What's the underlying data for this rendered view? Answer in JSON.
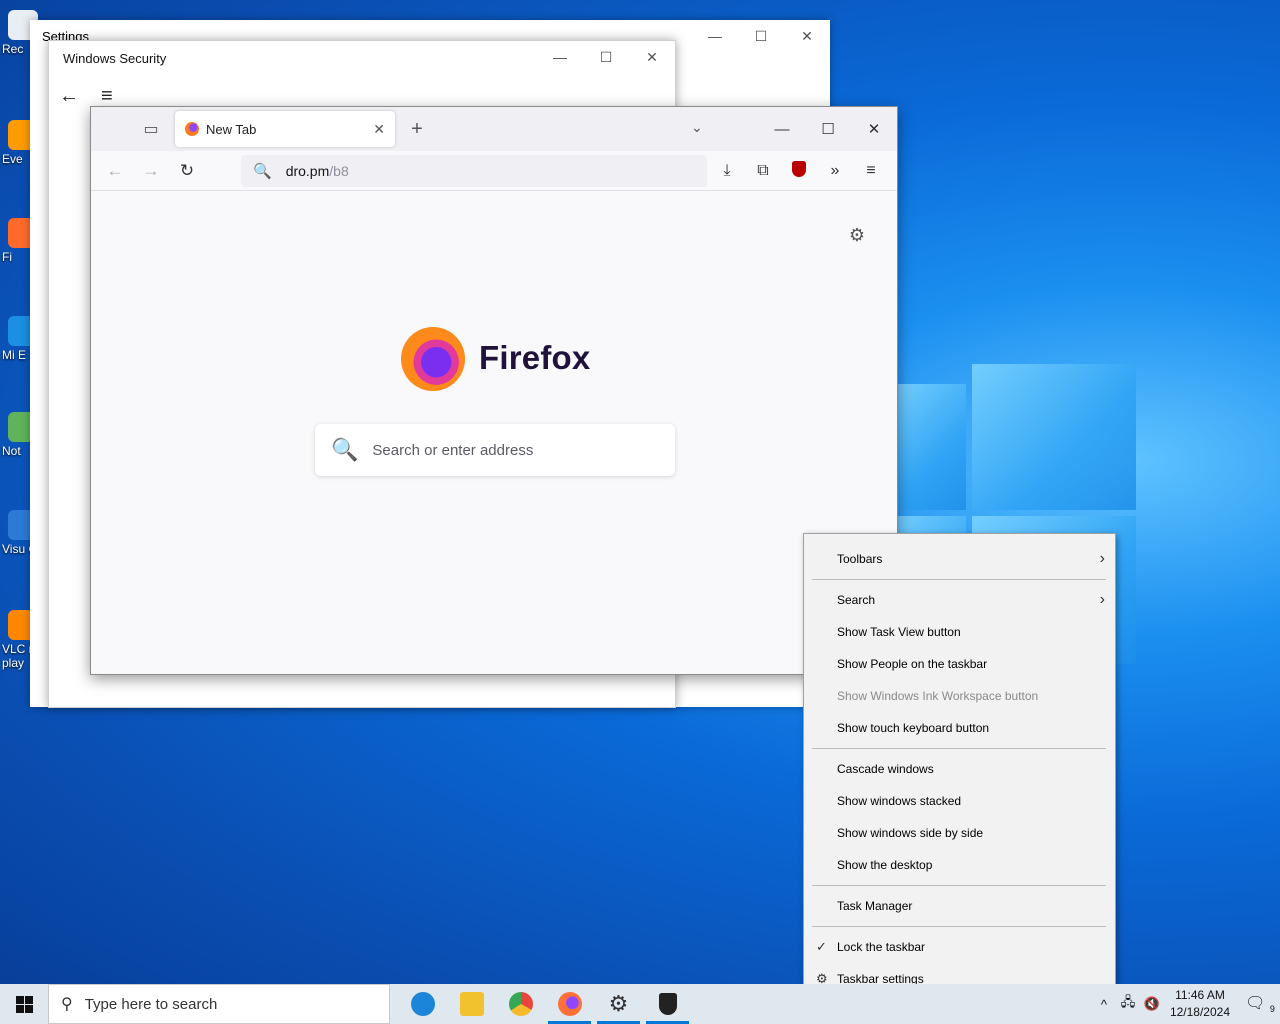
{
  "desktop": {
    "icons": [
      {
        "label": "Rec",
        "color": "#e9eef5"
      },
      {
        "label": "Eve",
        "color": "#ff9a00"
      },
      {
        "label": "Fi",
        "color": "#ff6a2b"
      },
      {
        "label": "Mi E",
        "color": "#1a8fe3"
      },
      {
        "label": "Not",
        "color": "#5fb35a"
      },
      {
        "label": "Visu C",
        "color": "#2c7ad6"
      },
      {
        "label": "VLC me play",
        "color": "#ff8800"
      }
    ]
  },
  "settings_window": {
    "title": "Settings",
    "controls": {
      "minimize": "—",
      "maximize": "☐",
      "close": "✕"
    }
  },
  "security_window": {
    "title": "Windows Security",
    "back_icon": "←",
    "menu_icon": "≡",
    "controls": {
      "minimize": "—",
      "maximize": "☐",
      "close": "✕"
    }
  },
  "firefox": {
    "tab": {
      "label": "New Tab",
      "close": "✕"
    },
    "new_tab": "+",
    "list_tabs": "⌄",
    "controls": {
      "minimize": "—",
      "maximize": "☐",
      "close": "✕"
    },
    "nav": {
      "back": "←",
      "forward": "→",
      "reload": "↻"
    },
    "url": {
      "host": "dro.pm",
      "path": "/b8",
      "icon": "🔍"
    },
    "tools": {
      "download": "⤓",
      "extensions": "⧉",
      "overflow": "»",
      "menu": "≡"
    },
    "content": {
      "settings_icon": "⚙",
      "wordmark": "Firefox",
      "search_placeholder": "Search or enter address",
      "search_icon": "🔍"
    }
  },
  "context_menu": {
    "items": [
      {
        "label": "Toolbars",
        "submenu": true
      },
      {
        "label": "Search",
        "submenu": true
      },
      {
        "label": "Show Task View button"
      },
      {
        "label": "Show People on the taskbar"
      },
      {
        "label": "Show Windows Ink Workspace button",
        "disabled": true
      },
      {
        "label": "Show touch keyboard button"
      },
      {
        "label": "Cascade windows"
      },
      {
        "label": "Show windows stacked"
      },
      {
        "label": "Show windows side by side"
      },
      {
        "label": "Show the desktop"
      },
      {
        "label": "Task Manager"
      },
      {
        "label": "Lock the taskbar",
        "checked": true
      },
      {
        "label": "Taskbar settings",
        "icon": "gear"
      }
    ],
    "chevron": "›",
    "check": "✓",
    "gear": "⚙"
  },
  "taskbar": {
    "search_placeholder": "Type here to search",
    "search_icon": "⚲",
    "apps": [
      {
        "name": "Microsoft Edge",
        "color": "#1b86d9",
        "active": false
      },
      {
        "name": "File Explorer",
        "color": "#f2c12e",
        "active": false
      },
      {
        "name": "Google Chrome",
        "color": "#e8453c",
        "active": false
      },
      {
        "name": "Firefox",
        "color": "#ff7139",
        "active": true
      },
      {
        "name": "Settings",
        "color": "#333333",
        "active": true
      },
      {
        "name": "Windows Security",
        "color": "#222222",
        "active": true
      }
    ],
    "tray": {
      "chevron": "^",
      "network": "🖧",
      "volume": "🔇",
      "time": "11:46 AM",
      "date": "12/18/2024",
      "notification_icon": "🗨",
      "notification_count": "9"
    }
  }
}
